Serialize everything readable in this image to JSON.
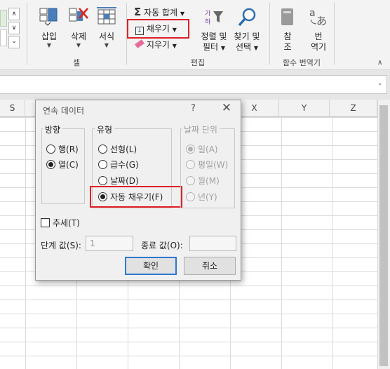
{
  "ribbon": {
    "cells_group": {
      "label": "셀",
      "insert": {
        "label": "삽입",
        "icon": "insert-cells-icon"
      },
      "delete": {
        "label": "삭제",
        "icon": "delete-cells-icon"
      },
      "format": {
        "label": "서식",
        "icon": "format-cells-icon"
      }
    },
    "editing_group": {
      "label": "편집",
      "autosum": {
        "label": "자동 합계",
        "icon": "sigma-icon"
      },
      "fill": {
        "label": "채우기",
        "icon": "fill-down-icon"
      },
      "clear": {
        "label": "지우기",
        "icon": "eraser-icon"
      },
      "sort_filter": {
        "line1": "정렬 및",
        "line2": "필터",
        "icon": "sort-filter-icon"
      },
      "find_select": {
        "line1": "찾기 및",
        "line2": "선택",
        "icon": "magnifier-icon"
      }
    },
    "function_group": {
      "label": "함수 번역기",
      "reference": {
        "line1": "참",
        "line2": "조",
        "icon": "book-icon"
      },
      "translator": {
        "line1": "번",
        "line2": "역기",
        "icon": "translate-icon"
      }
    },
    "collapse_icon": "chevron-up-icon"
  },
  "columns": [
    "S",
    "X",
    "Y",
    "Z"
  ],
  "dialog": {
    "title": "연속 데이터",
    "help": "?",
    "close": "✕",
    "series_in": {
      "legend": "방향",
      "options": [
        {
          "label": "행(R)",
          "checked": false
        },
        {
          "label": "열(C)",
          "checked": true
        }
      ]
    },
    "type": {
      "legend": "유형",
      "options": [
        {
          "label": "선형(L)",
          "checked": false
        },
        {
          "label": "급수(G)",
          "checked": false
        },
        {
          "label": "날짜(D)",
          "checked": false
        },
        {
          "label": "자동 채우기(F)",
          "checked": true
        }
      ]
    },
    "date_unit": {
      "legend": "날짜 단위",
      "options": [
        {
          "label": "일(A)",
          "checked": true
        },
        {
          "label": "평일(W)",
          "checked": false
        },
        {
          "label": "월(M)",
          "checked": false
        },
        {
          "label": "년(Y)",
          "checked": false
        }
      ]
    },
    "trend": {
      "label": "추세(T)",
      "checked": false
    },
    "step_value": {
      "label": "단계 값(S):",
      "value": "1"
    },
    "stop_value": {
      "label": "종료 값(O):",
      "value": ""
    },
    "ok": "확인",
    "cancel": "취소"
  },
  "colors": {
    "highlight": "#e01f26",
    "default_button_border": "#2d77d1"
  }
}
